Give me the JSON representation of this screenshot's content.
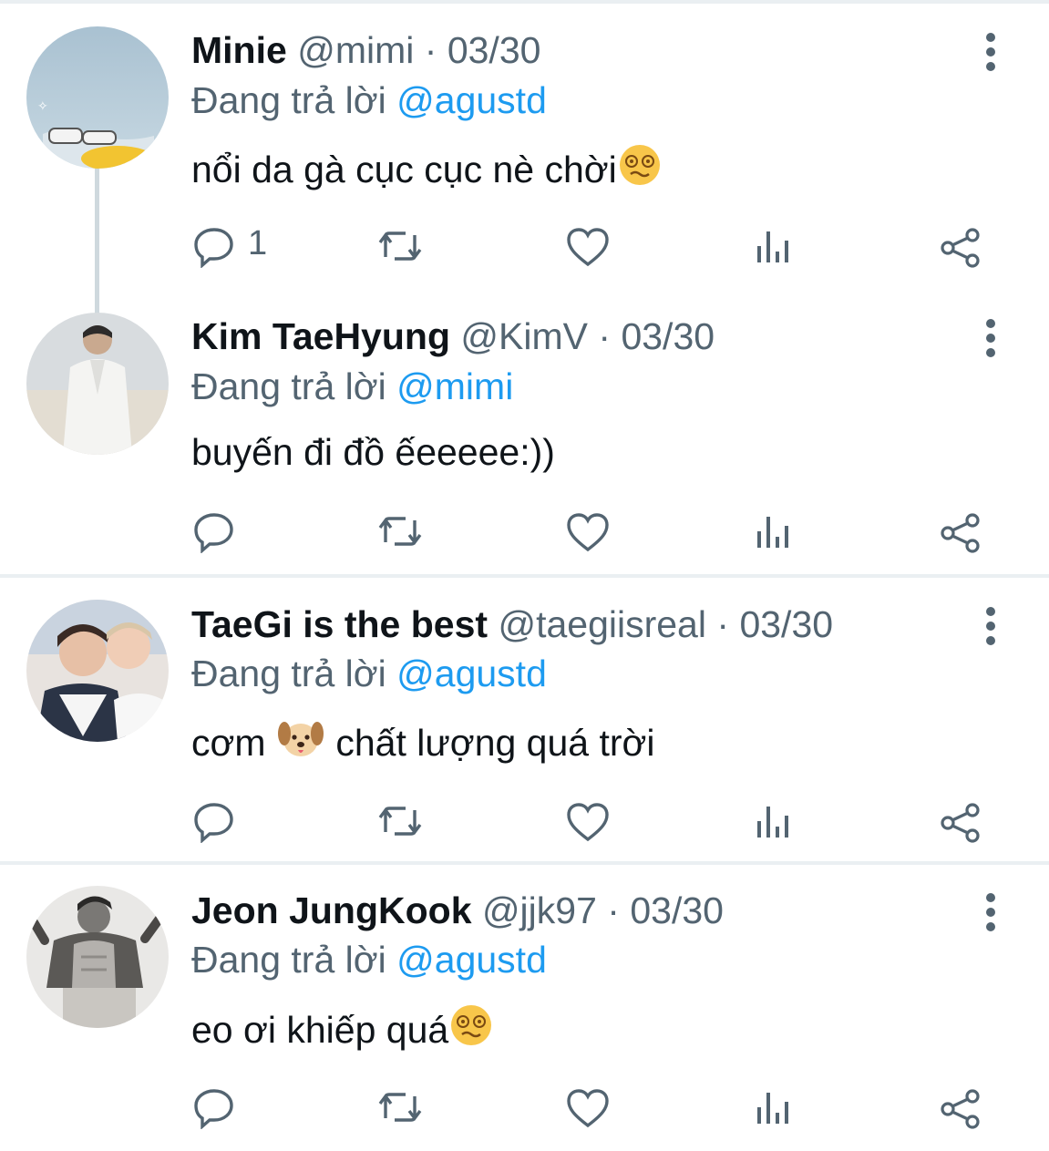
{
  "tweets": [
    {
      "name": "Minie",
      "handle": "@mimi",
      "date": "03/30",
      "replying_prefix": "Đang trả lời",
      "replying_to": "@agustd",
      "text": "nổi da gà cục cục nè chời",
      "text_emoji": "woozy-face",
      "reply_count": "1"
    },
    {
      "name": "Kim TaeHyung",
      "handle": "@KimV",
      "date": "03/30",
      "replying_prefix": "Đang trả lời",
      "replying_to": "@mimi",
      "text": "buyến đi đồ ếeeeee:))",
      "reply_count": ""
    },
    {
      "name": "TaeGi is the best",
      "handle": "@taegiisreal",
      "date": "03/30",
      "replying_prefix": "Đang trả lời",
      "replying_to": "@agustd",
      "text_before": "cơm",
      "text_emoji": "dog-face",
      "text_after": "chất lượng quá trời",
      "reply_count": ""
    },
    {
      "name": "Jeon JungKook",
      "handle": "@jjk97",
      "date": "03/30",
      "replying_prefix": "Đang trả lời",
      "replying_to": "@agustd",
      "text": "eo ơi khiếp quá",
      "text_emoji": "woozy-face",
      "reply_count": ""
    }
  ],
  "separator": "·",
  "colors": {
    "text_primary": "#0f1419",
    "text_secondary": "#536471",
    "accent": "#1d9bf0",
    "thread_line": "#cfd9de",
    "divider": "#eaeff2"
  },
  "icons": [
    "reply-icon",
    "retweet-icon",
    "like-icon",
    "views-icon",
    "share-icon",
    "more-icon"
  ]
}
